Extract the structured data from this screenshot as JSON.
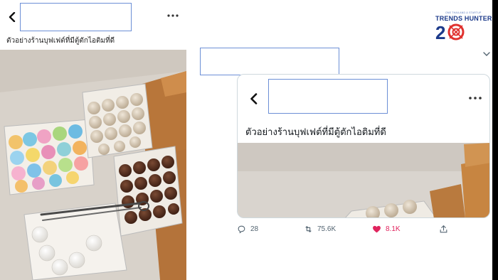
{
  "left_post": {
    "caption": "ตัวอย่างร้านบุฟเฟต์ที่มีตู้ตักไอติมที่ดี",
    "back_icon": "chevron-left-icon",
    "more_icon": "more-dots-icon"
  },
  "brand": {
    "tagline": "ONE THAILAND & STARTUP",
    "name": "TRENDS HUNTER",
    "number": "20",
    "colors": {
      "blue": "#1c3a8a",
      "red": "#e0312e"
    }
  },
  "card": {
    "caption": "ตัวอย่างร้านบุฟเฟต์ที่มีตู้ตักไอติมที่ดี",
    "back_icon": "chevron-left-icon",
    "more_icon": "more-dots-icon",
    "expand_icon": "chevron-down-icon"
  },
  "actions": {
    "reply_count": "28",
    "retweet_count": "75.6K",
    "like_count": "8.1K",
    "like_color": "#e0245e",
    "icons": [
      "reply-icon",
      "retweet-icon",
      "like-icon",
      "share-icon"
    ]
  }
}
